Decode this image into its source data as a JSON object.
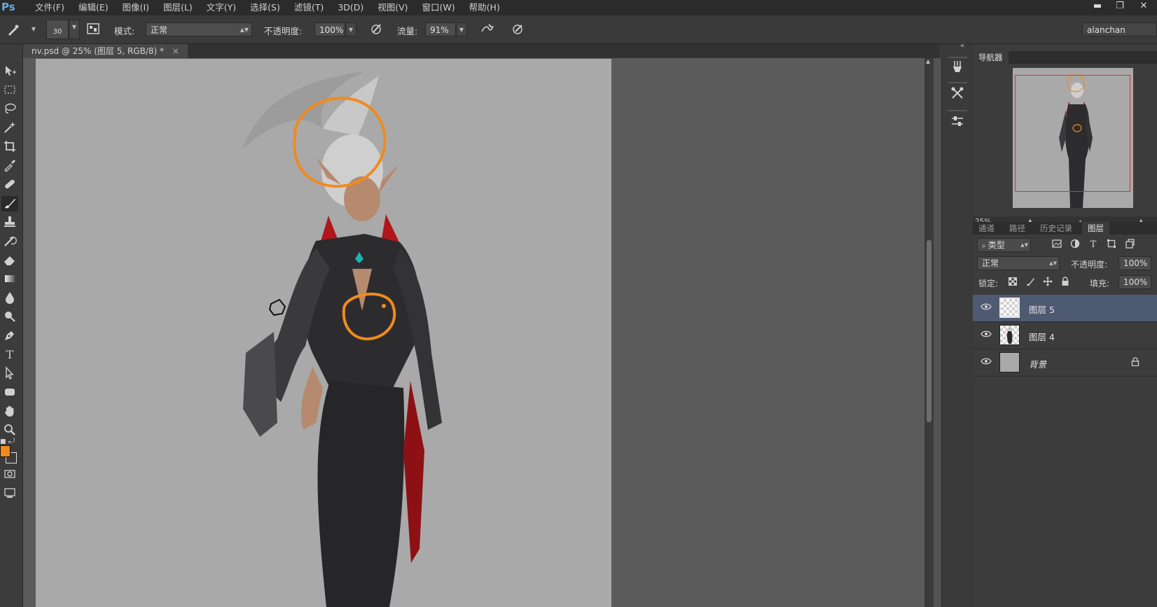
{
  "app": {
    "logo": "Ps"
  },
  "menu": [
    "文件(F)",
    "编辑(E)",
    "图像(I)",
    "图层(L)",
    "文字(Y)",
    "选择(S)",
    "滤镜(T)",
    "3D(D)",
    "视图(V)",
    "窗口(W)",
    "帮助(H)"
  ],
  "window_controls": {
    "minimize": "▬",
    "restore": "❐",
    "close": "✕"
  },
  "options": {
    "brush_size": "30",
    "mode_label": "模式:",
    "mode_value": "正常",
    "opacity_label": "不透明度:",
    "opacity_value": "100%",
    "flow_label": "流量:",
    "flow_value": "91%",
    "user": "alanchan"
  },
  "document": {
    "tab_title": "nv.psd @ 25% (图层 5, RGB/8) *",
    "close": "×"
  },
  "colors": {
    "foreground": "#f08b1e",
    "background": "#3c3c3c",
    "canvas": "#a9a9a9",
    "annotation": "#f08b1e",
    "selected_layer": "#4e5a71",
    "navigator_frame": "#e03030"
  },
  "navigator": {
    "tab": "导航器",
    "zoom": "25%"
  },
  "layers_panel": {
    "tabs": [
      "通道",
      "路径",
      "历史记录",
      "图层"
    ],
    "active_tab": "图层",
    "filter_label": "类型",
    "blend_mode": "正常",
    "opacity_label": "不透明度:",
    "opacity_value": "100%",
    "lock_label": "锁定:",
    "fill_label": "填充:",
    "fill_value": "100%",
    "layers": [
      {
        "name": "图层 5",
        "selected": true,
        "locked": false
      },
      {
        "name": "图层 4",
        "selected": false,
        "locked": false
      },
      {
        "name": "背景",
        "selected": false,
        "locked": true
      }
    ]
  },
  "icons": {
    "tools": [
      "move-icon",
      "marquee-icon",
      "lasso-icon",
      "magic-wand-icon",
      "crop-icon",
      "eyedropper-icon",
      "healing-brush-icon",
      "brush-icon",
      "clone-stamp-icon",
      "history-brush-icon",
      "eraser-icon",
      "gradient-icon",
      "blur-icon",
      "dodge-icon",
      "pen-icon",
      "type-icon",
      "path-selection-icon",
      "shape-icon",
      "hand-icon",
      "zoom-icon"
    ],
    "dock": [
      "puppet-icon",
      "tools-preset-icon",
      "adjust-icon"
    ]
  }
}
